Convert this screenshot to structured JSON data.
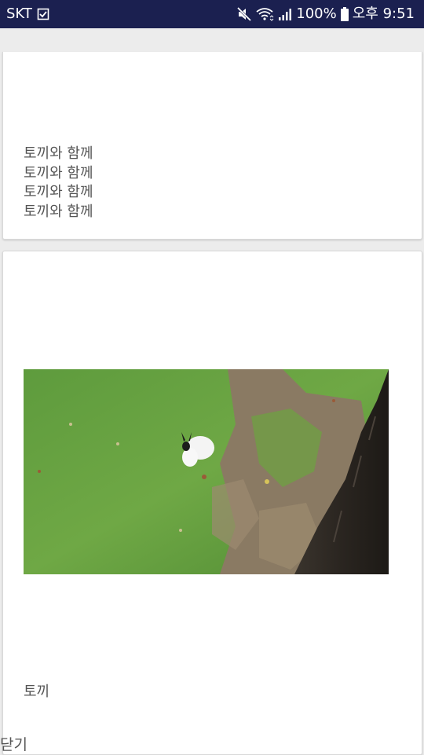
{
  "status_bar": {
    "carrier": "SKT",
    "battery": "100%",
    "time": "오후 9:51",
    "background": "#1b2050",
    "icons": [
      "checkbox-notification-icon",
      "mute-icon",
      "wifi-icon",
      "signal-icon",
      "battery-icon"
    ]
  },
  "cards": [
    {
      "lines": [
        "토끼와 함께",
        "토끼와 함께",
        "토끼와 함께",
        "토끼와 함께"
      ]
    },
    {
      "image": "rabbit-on-grass-photo",
      "caption": "토끼"
    }
  ],
  "close_label": "닫기",
  "colors": {
    "text": "#555555",
    "card_background": "#ffffff",
    "page_background": "#ececec"
  }
}
